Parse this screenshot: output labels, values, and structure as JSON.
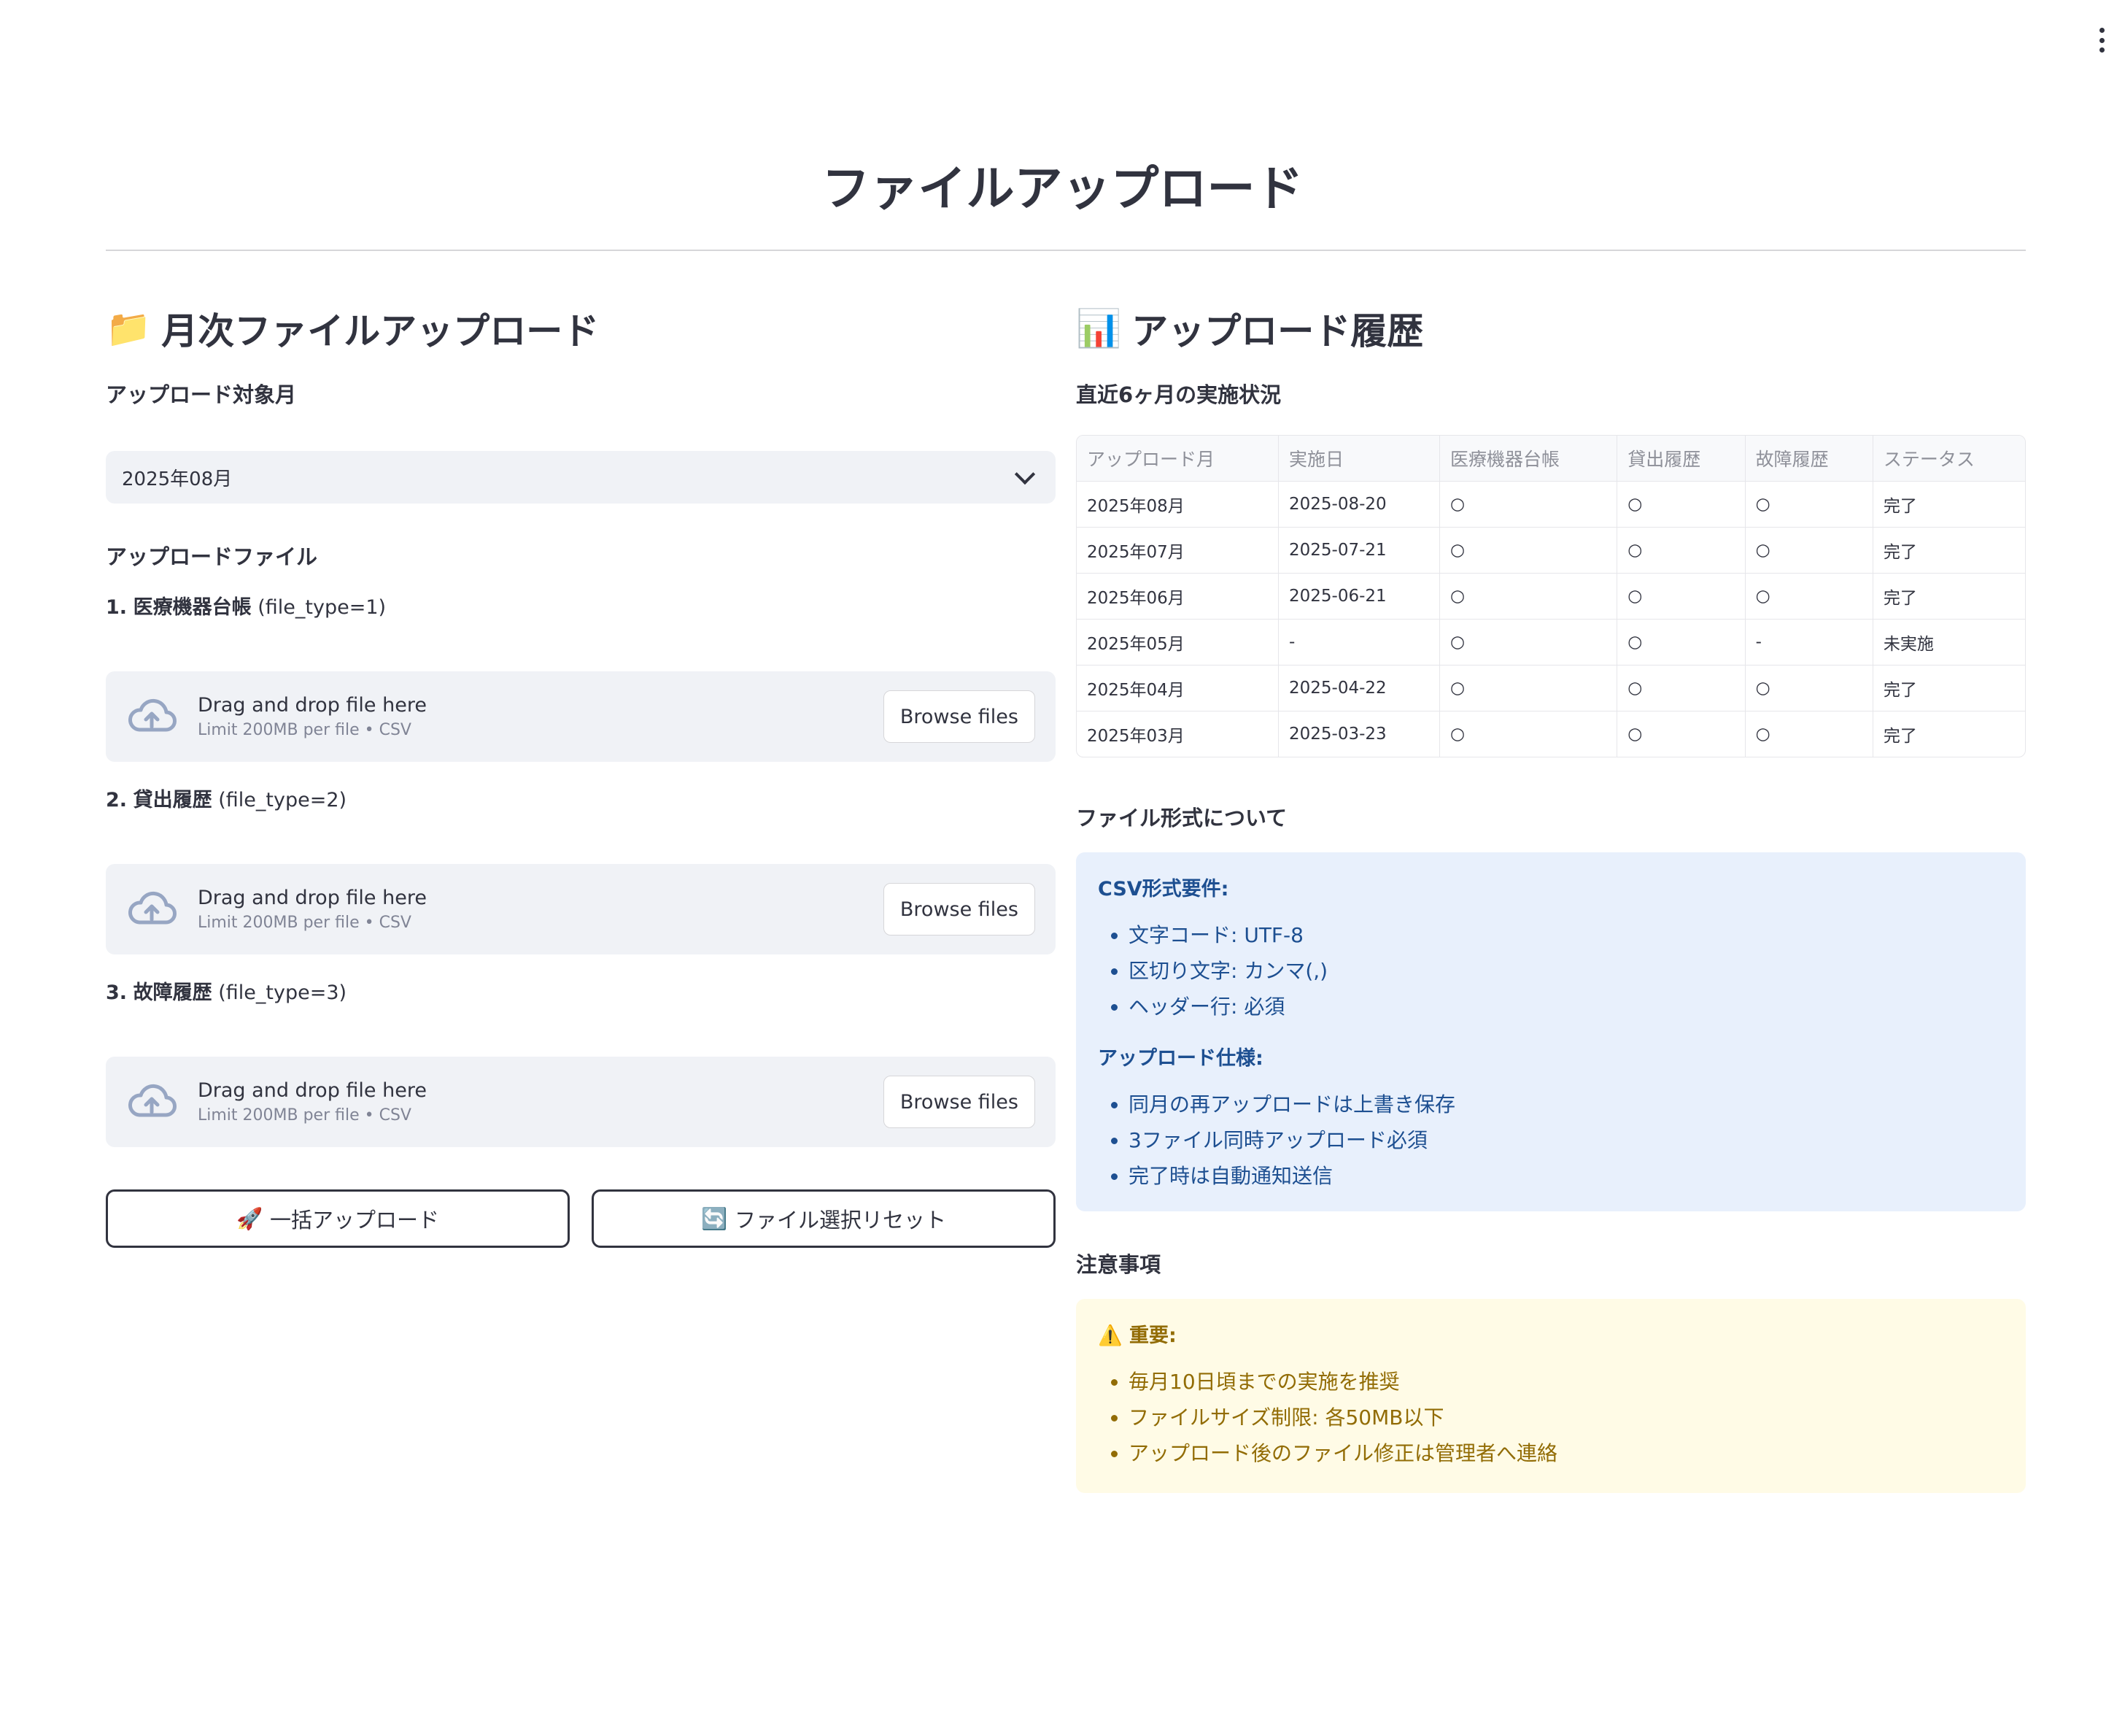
{
  "page": {
    "title": "ファイルアップロード"
  },
  "left": {
    "heading_icon": "📁",
    "heading": "月次ファイルアップロード",
    "month_label": "アップロード対象月",
    "month_value": "2025年08月",
    "files_label": "アップロードファイル",
    "files": [
      {
        "num": "1.",
        "name": "医療機器台帳",
        "type": "(file_type=1)",
        "drop_text": "Drag and drop file here",
        "limit": "Limit 200MB per file • CSV",
        "browse": "Browse files"
      },
      {
        "num": "2.",
        "name": "貸出履歴",
        "type": "(file_type=2)",
        "drop_text": "Drag and drop file here",
        "limit": "Limit 200MB per file • CSV",
        "browse": "Browse files"
      },
      {
        "num": "3.",
        "name": "故障履歴",
        "type": "(file_type=3)",
        "drop_text": "Drag and drop file here",
        "limit": "Limit 200MB per file • CSV",
        "browse": "Browse files"
      }
    ],
    "upload_button": {
      "icon": "🚀",
      "label": "一括アップロード"
    },
    "reset_button": {
      "icon": "🔄",
      "label": "ファイル選択リセット"
    }
  },
  "right": {
    "heading_icon": "📊",
    "heading": "アップロード履歴",
    "table_label": "直近6ヶ月の実施状況",
    "table": {
      "columns": [
        "アップロード月",
        "実施日",
        "医療機器台帳",
        "貸出履歴",
        "故障履歴",
        "ステータス"
      ],
      "rows": [
        [
          "2025年08月",
          "2025-08-20",
          "○",
          "○",
          "○",
          "完了"
        ],
        [
          "2025年07月",
          "2025-07-21",
          "○",
          "○",
          "○",
          "完了"
        ],
        [
          "2025年06月",
          "2025-06-21",
          "○",
          "○",
          "○",
          "完了"
        ],
        [
          "2025年05月",
          "-",
          "○",
          "○",
          "-",
          "未実施"
        ],
        [
          "2025年04月",
          "2025-04-22",
          "○",
          "○",
          "○",
          "完了"
        ],
        [
          "2025年03月",
          "2025-03-23",
          "○",
          "○",
          "○",
          "完了"
        ]
      ]
    },
    "format_label": "ファイル形式について",
    "info": {
      "csv_head": "CSV形式要件:",
      "csv_items": [
        "文字コード: UTF-8",
        "区切り文字: カンマ(,)",
        "ヘッダー行: 必須"
      ],
      "upload_head": "アップロード仕様:",
      "upload_items": [
        "同月の再アップロードは上書き保存",
        "3ファイル同時アップロード必須",
        "完了時は自動通知送信"
      ]
    },
    "notes_label": "注意事項",
    "warn": {
      "icon": "⚠️",
      "head": "重要:",
      "items": [
        "毎月10日頃までの実施を推奨",
        "ファイルサイズ制限: 各50MB以下",
        "アップロード後のファイル修正は管理者へ連絡"
      ]
    }
  }
}
